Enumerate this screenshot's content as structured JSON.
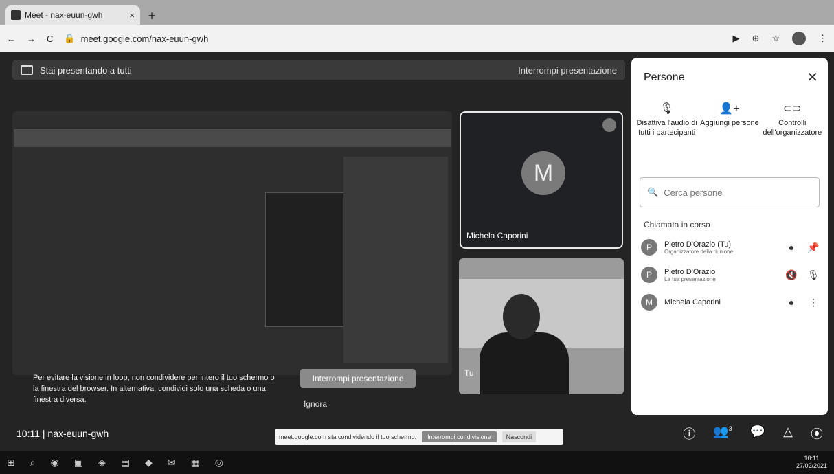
{
  "browser": {
    "tab_title": "Meet - nax-euun-gwh",
    "tab_close": "×",
    "new_tab": "+",
    "url": "meet.google.com/nax-euun-gwh"
  },
  "banner": {
    "text": "Stai presentando a tutti",
    "stop": "Interrompi presentazione"
  },
  "tiles": {
    "michela_initial": "M",
    "michela_name": "Michela Caporini",
    "tu_name": "Tu"
  },
  "warning": {
    "text": "Per evitare la visione in loop, non condividere per intero il tuo schermo o la finestra del browser. In alternativa, condividi solo una scheda o una finestra diversa.",
    "stop_button": "Interrompi presentazione",
    "ignore": "Ignora"
  },
  "people_panel": {
    "title": "Persone",
    "actions": [
      {
        "label": "Disattiva l'audio di tutti i partecipanti"
      },
      {
        "label": "Aggiungi persone"
      },
      {
        "label": "Controlli dell'organizzatore"
      }
    ],
    "search_placeholder": "Cerca persone",
    "call_header": "Chiamata in corso",
    "participants": [
      {
        "initial": "P",
        "name": "Pietro D'Orazio (Tu)",
        "sub": "Organizzatore della riunione"
      },
      {
        "initial": "P",
        "name": "Pietro D'Orazio",
        "sub": "La tua presentazione"
      },
      {
        "initial": "M",
        "name": "Michela Caporini",
        "sub": ""
      }
    ]
  },
  "bottom": {
    "meeting_info": "10:11 | nax-euun-gwh",
    "people_count": "3"
  },
  "toast": {
    "text": "meet.google.com sta condividendo il tuo schermo.",
    "stop": "Interrompi condivisione",
    "hide": "Nascondi"
  },
  "taskbar": {
    "time": "10:11",
    "date": "27/02/2021"
  }
}
